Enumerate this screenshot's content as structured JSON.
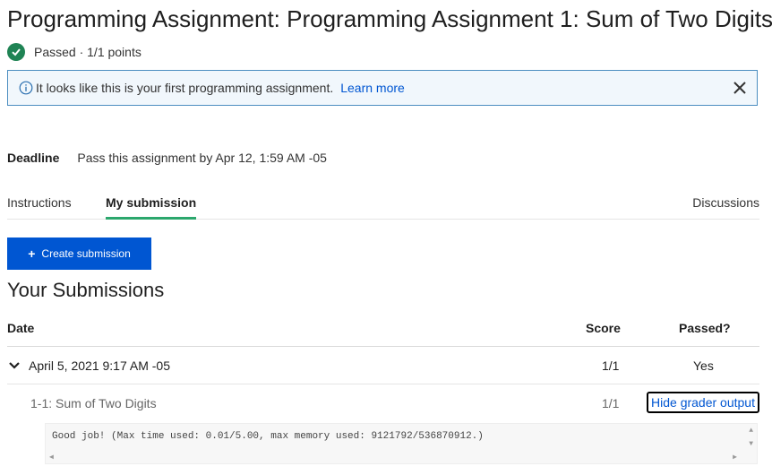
{
  "page": {
    "title": "Programming Assignment: Programming Assignment 1: Sum of Two Digits",
    "status_text": "Passed · 1/1 points"
  },
  "banner": {
    "message": "It looks like this is your first programming assignment.",
    "link_label": "Learn more"
  },
  "deadline": {
    "label": "Deadline",
    "value": "Pass this assignment by Apr 12, 1:59 AM -05"
  },
  "tabs": [
    {
      "label": "Instructions",
      "active": false
    },
    {
      "label": "My submission",
      "active": true
    },
    {
      "label": "Discussions",
      "active": false
    }
  ],
  "create_button_label": "Create submission",
  "submissions": {
    "heading": "Your Submissions",
    "columns": {
      "date": "Date",
      "score": "Score",
      "passed": "Passed?"
    },
    "rows": [
      {
        "date": "April 5, 2021 9:17 AM -05",
        "score": "1/1",
        "passed": "Yes",
        "parts": [
          {
            "name": "1-1: Sum of Two Digits",
            "score": "1/1",
            "action_label": "Hide grader output",
            "output": "Good job! (Max time used: 0.01/5.00, max memory used: 9121792/536870912.)"
          }
        ]
      }
    ]
  },
  "icons": {
    "status": "check-circle-icon",
    "banner": "info-icon",
    "close": "close-icon",
    "create": "plus-icon",
    "expand": "chevron-down-icon"
  },
  "colors": {
    "success": "#1f8354",
    "link": "#0056d2",
    "primary_button": "#0056d2",
    "banner_border": "#4c8ec0",
    "banner_bg": "#f1f7fc",
    "tab_underline": "#2ca76d"
  }
}
